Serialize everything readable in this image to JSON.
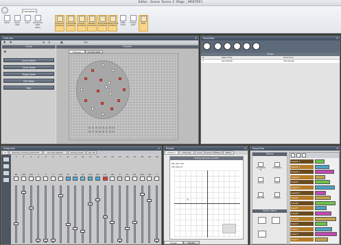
{
  "window": {
    "title": "Editor - Scene 'Scene 1' (Page '_MASTER')"
  },
  "ribbon": {
    "tab": "Controllers",
    "buttons": [
      {
        "label": "Save"
      },
      {
        "label": "Save next"
      },
      {
        "label": "Live"
      },
      {
        "label": "Show the light beam"
      },
      {
        "label": "Fixtures window"
      },
      {
        "label": "Channels window"
      },
      {
        "label": "Preset window"
      },
      {
        "label": "Palette window"
      },
      {
        "label": "EasyStep window"
      },
      {
        "label": "EasyTime window"
      },
      {
        "label": "DMX input"
      },
      {
        "label": "Follow spot"
      },
      {
        "label": "Midi"
      }
    ]
  },
  "fixtures": {
    "title": "Fixtures",
    "group_header": "Group",
    "fixtures_header": "Fixtures",
    "tabs": [
      "Fixtures",
      "Groups test"
    ],
    "groups": [
      "Circle Matrix",
      "Circle Spots",
      "Stage Spots",
      "CMY Wash",
      "Rest"
    ],
    "text_btn": "Txt"
  },
  "easystep": {
    "title": "EasyStep",
    "steps_header": "Steps",
    "cols": [
      "#",
      "Fade Time",
      "Hold Time"
    ],
    "row": {
      "n": "1",
      "fade": "00m00s00",
      "hold": "00m01s00"
    }
  },
  "channels": {
    "title": "Channels",
    "tabs": [
      "All",
      "Dimmer moving head 575",
      "led wall washer",
      "moving head",
      "par 36"
    ],
    "numbers": [
      "1",
      "2",
      "3",
      "4",
      "5",
      "6",
      "7",
      "8",
      "9",
      "10",
      "11",
      "12",
      "13",
      "14",
      "15",
      "16",
      "17",
      "18",
      "19",
      "20"
    ],
    "values": [
      "80",
      "230",
      "153",
      "0",
      "0",
      "0",
      "213",
      "75",
      "56",
      "44",
      "174",
      "192",
      "111",
      "85",
      "0",
      "57",
      "85",
      "220",
      "191",
      "0"
    ]
  },
  "preset": {
    "title": "Preset",
    "tabs": [
      "Position",
      "Intensity",
      "Color",
      "Gobo",
      "Beam",
      "Effect"
    ],
    "active": "Position",
    "hint": "Follow with pan and tilt",
    "pan": "Pan 40-1.00",
    "tilt": "Tilt 150.15",
    "bottom_tabs": [
      "Preset",
      "Palette"
    ]
  },
  "easytime": {
    "title": "EasyTime",
    "effects_header": "Effects",
    "matrix_header": "Matrix effect",
    "effects": [
      "Constant fx",
      "Gradient",
      "Curve",
      "Color",
      "Pan Tilt",
      "Chaser"
    ],
    "sequence": [
      "Snap01 1",
      "Snap01 2",
      "Snap02 1",
      "Snap02 2",
      "Snap03",
      "Snap04 1",
      "Snap04 2",
      "Snap05",
      "Snap06",
      "Snap07",
      "Snap08",
      "Snap09",
      "Snap10",
      "Snap11",
      "Snap12",
      "Snap13"
    ]
  }
}
